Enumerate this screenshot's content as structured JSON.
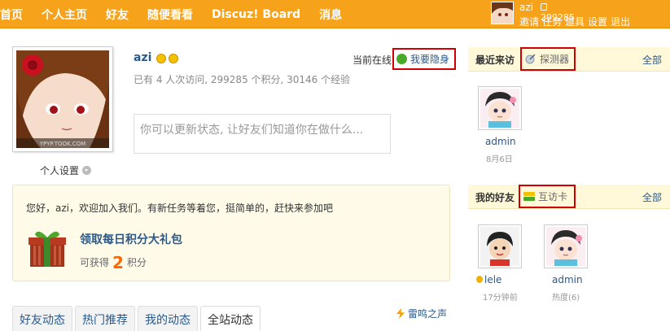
{
  "nav": {
    "items": [
      "首页",
      "个人主页",
      "好友",
      "随便看看",
      "Discuz! Board",
      "消息"
    ]
  },
  "user": {
    "name": "azi",
    "credit": "299285",
    "links": [
      "邀请",
      "任务",
      "道具",
      "设置",
      "退出"
    ]
  },
  "profile": {
    "name": "azi",
    "stats": "已有 4 人次访问, 299285 个积分, 30146 个经验",
    "online_label": "当前在线",
    "hide_label": "我要隐身",
    "status_placeholder": "你可以更新状态, 让好友们知道你在做什么...",
    "settings_label": "个人设置",
    "avatar_watermark": "YPYP.TOOK.COM"
  },
  "welcome": {
    "text": "您好，azi，欢迎加入我们。有新任务等着您，挺简单的，赶快来参加吧",
    "gift_title": "领取每日积分大礼包",
    "gift_prefix": "可获得",
    "gift_amount": "2",
    "gift_suffix": "积分"
  },
  "tabs": [
    "好友动态",
    "热门推荐",
    "我的动态",
    "全站动态"
  ],
  "thunder_label": "雷鸣之声",
  "recent_visitors": {
    "title": "最近来访",
    "tool_label": "探测器",
    "all_label": "全部",
    "items": [
      {
        "name": "admin",
        "meta": "8月6日"
      }
    ]
  },
  "friends": {
    "title": "我的好友",
    "tool_label": "互访卡",
    "all_label": "全部",
    "items": [
      {
        "name": "lele",
        "meta": "17分钟前"
      },
      {
        "name": "admin",
        "meta": "热度(6)"
      }
    ]
  },
  "colors": {
    "topbar": "#f7a21b",
    "link": "#2b5a8a",
    "highlight_border": "#d10000",
    "accent": "#ff6600"
  }
}
